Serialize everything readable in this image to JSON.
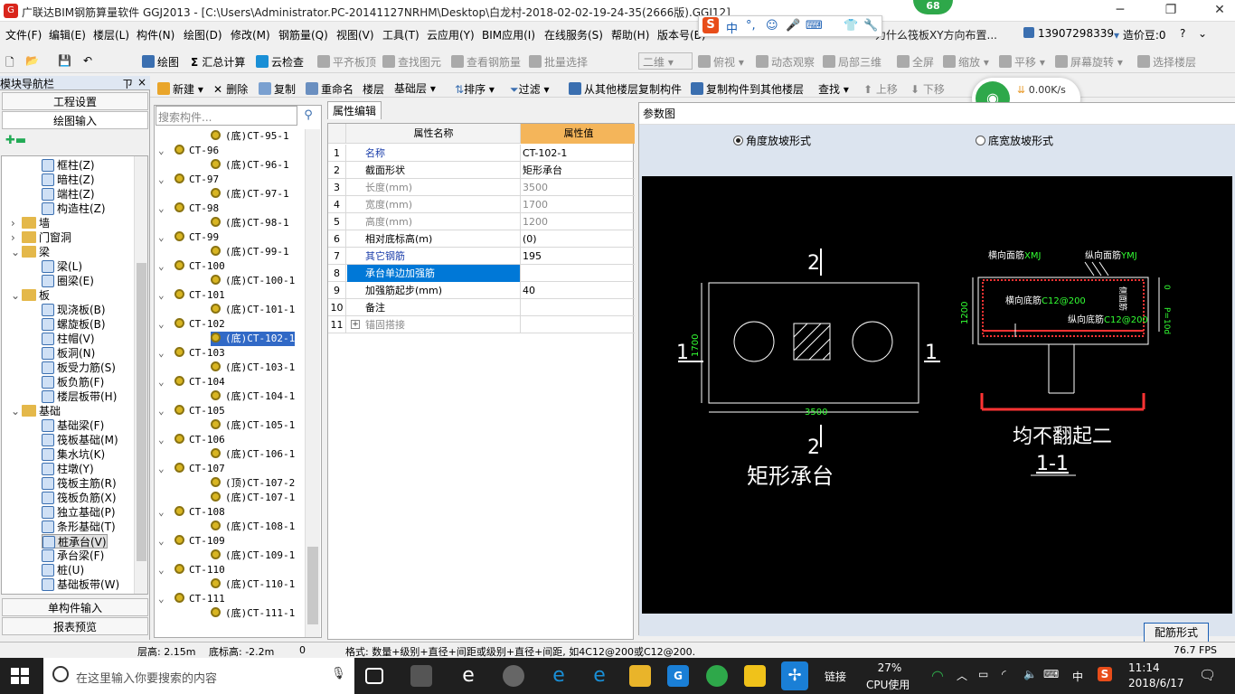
{
  "window": {
    "title": "广联达BIM钢筋算量软件 GGJ2013 - [C:\\Users\\Administrator.PC-20141127NRHM\\Desktop\\白龙村-2018-02-02-19-24-35(2666版).GGJ12]",
    "score_badge": "68"
  },
  "ime": {
    "items": [
      "中",
      "°,",
      "☺",
      "🎤",
      "⌨",
      "👕",
      "🔧"
    ]
  },
  "menu": {
    "items": [
      "文件(F)",
      "编辑(E)",
      "楼层(L)",
      "构件(N)",
      "绘图(D)",
      "修改(M)",
      "钢筋量(Q)",
      "视图(V)",
      "工具(T)",
      "云应用(Y)",
      "BIM应用(I)",
      "在线服务(S)",
      "帮助(H)",
      "版本号(B)"
    ],
    "news_text": "为什么筏板XY方向布置...",
    "phone": "13907298339",
    "price_beans": "造价豆:0"
  },
  "toolbar1": {
    "draw": "绘图",
    "sum": "汇总计算",
    "cloud_check": "云检查",
    "flat_top": "平齐板顶",
    "find_elem": "查找图元",
    "view_rebar": "查看钢筋量",
    "batch_select": "批量选择",
    "view_mode": "二维",
    "top_view": "俯视",
    "dynamic_view": "动态观察",
    "local_3d": "局部三维",
    "fullscreen": "全屏",
    "zoom": "缩放",
    "pan": "平移",
    "rotate_screen": "屏幕旋转",
    "select_floor": "选择楼层"
  },
  "toolbar2": {
    "new": "新建",
    "delete": "删除",
    "copy": "复制",
    "rename": "重命名",
    "floor_label": "楼层",
    "floor_value": "基础层",
    "sort": "排序",
    "filter": "过滤",
    "copy_from_other": "从其他楼层复制构件",
    "copy_to_other": "复制构件到其他楼层",
    "find": "查找",
    "move_up": "上移",
    "move_down": "下移"
  },
  "network": {
    "down": "0.00K/s",
    "up": "0"
  },
  "left_nav": {
    "title": "模块导航栏",
    "pin": "ㄗ",
    "close": "×",
    "btn_project": "工程设置",
    "btn_draw": "绘图输入",
    "btn_single": "单构件输入",
    "btn_report": "报表预览",
    "tree": [
      {
        "label": "框柱(Z)",
        "level": 2,
        "type": "comp"
      },
      {
        "label": "暗柱(Z)",
        "level": 2,
        "type": "comp"
      },
      {
        "label": "端柱(Z)",
        "level": 2,
        "type": "comp"
      },
      {
        "label": "构造柱(Z)",
        "level": 2,
        "type": "comp"
      },
      {
        "label": "墙",
        "level": 1,
        "type": "folder",
        "exp": ">"
      },
      {
        "label": "门窗洞",
        "level": 1,
        "type": "folder",
        "exp": ">"
      },
      {
        "label": "梁",
        "level": 1,
        "type": "folder",
        "exp": "v"
      },
      {
        "label": "梁(L)",
        "level": 2,
        "type": "comp"
      },
      {
        "label": "圈梁(E)",
        "level": 2,
        "type": "comp"
      },
      {
        "label": "板",
        "level": 1,
        "type": "folder",
        "exp": "v"
      },
      {
        "label": "现浇板(B)",
        "level": 2,
        "type": "comp"
      },
      {
        "label": "螺旋板(B)",
        "level": 2,
        "type": "comp"
      },
      {
        "label": "柱帽(V)",
        "level": 2,
        "type": "comp"
      },
      {
        "label": "板洞(N)",
        "level": 2,
        "type": "comp"
      },
      {
        "label": "板受力筋(S)",
        "level": 2,
        "type": "comp"
      },
      {
        "label": "板负筋(F)",
        "level": 2,
        "type": "comp"
      },
      {
        "label": "楼层板带(H)",
        "level": 2,
        "type": "comp"
      },
      {
        "label": "基础",
        "level": 1,
        "type": "folder",
        "exp": "v"
      },
      {
        "label": "基础梁(F)",
        "level": 2,
        "type": "comp"
      },
      {
        "label": "筏板基础(M)",
        "level": 2,
        "type": "comp"
      },
      {
        "label": "集水坑(K)",
        "level": 2,
        "type": "comp"
      },
      {
        "label": "柱墩(Y)",
        "level": 2,
        "type": "comp"
      },
      {
        "label": "筏板主筋(R)",
        "level": 2,
        "type": "comp"
      },
      {
        "label": "筏板负筋(X)",
        "level": 2,
        "type": "comp"
      },
      {
        "label": "独立基础(P)",
        "level": 2,
        "type": "comp"
      },
      {
        "label": "条形基础(T)",
        "level": 2,
        "type": "comp"
      },
      {
        "label": "桩承台(V)",
        "level": 2,
        "type": "comp",
        "selected": true
      },
      {
        "label": "承台梁(F)",
        "level": 2,
        "type": "comp"
      },
      {
        "label": "桩(U)",
        "level": 2,
        "type": "comp"
      },
      {
        "label": "基础板带(W)",
        "level": 2,
        "type": "comp"
      }
    ]
  },
  "components": {
    "search_placeholder": "搜索构件...",
    "items": [
      {
        "label": "(底)CT-95-1",
        "level": 2
      },
      {
        "label": "CT-96",
        "level": 1
      },
      {
        "label": "(底)CT-96-1",
        "level": 2
      },
      {
        "label": "CT-97",
        "level": 1
      },
      {
        "label": "(底)CT-97-1",
        "level": 2
      },
      {
        "label": "CT-98",
        "level": 1
      },
      {
        "label": "(底)CT-98-1",
        "level": 2
      },
      {
        "label": "CT-99",
        "level": 1
      },
      {
        "label": "(底)CT-99-1",
        "level": 2
      },
      {
        "label": "CT-100",
        "level": 1
      },
      {
        "label": "(底)CT-100-1",
        "level": 2
      },
      {
        "label": "CT-101",
        "level": 1
      },
      {
        "label": "(底)CT-101-1",
        "level": 2
      },
      {
        "label": "CT-102",
        "level": 1
      },
      {
        "label": "(底)CT-102-1",
        "level": 2,
        "selected": true
      },
      {
        "label": "CT-103",
        "level": 1
      },
      {
        "label": "(底)CT-103-1",
        "level": 2
      },
      {
        "label": "CT-104",
        "level": 1
      },
      {
        "label": "(底)CT-104-1",
        "level": 2
      },
      {
        "label": "CT-105",
        "level": 1
      },
      {
        "label": "(底)CT-105-1",
        "level": 2
      },
      {
        "label": "CT-106",
        "level": 1
      },
      {
        "label": "(底)CT-106-1",
        "level": 2
      },
      {
        "label": "CT-107",
        "level": 1
      },
      {
        "label": "(顶)CT-107-2",
        "level": 2
      },
      {
        "label": "(底)CT-107-1",
        "level": 2
      },
      {
        "label": "CT-108",
        "level": 1
      },
      {
        "label": "(底)CT-108-1",
        "level": 2
      },
      {
        "label": "CT-109",
        "level": 1
      },
      {
        "label": "(底)CT-109-1",
        "level": 2
      },
      {
        "label": "CT-110",
        "level": 1
      },
      {
        "label": "(底)CT-110-1",
        "level": 2
      },
      {
        "label": "CT-111",
        "level": 1
      },
      {
        "label": "(底)CT-111-1",
        "level": 2
      }
    ]
  },
  "properties": {
    "tab": "属性编辑",
    "col_name": "属性名称",
    "col_value": "属性值",
    "rows": [
      {
        "no": "1",
        "name": "名称",
        "value": "CT-102-1",
        "style": "blue"
      },
      {
        "no": "2",
        "name": "截面形状",
        "value": "矩形承台",
        "style": ""
      },
      {
        "no": "3",
        "name": "长度(mm)",
        "value": "3500",
        "style": "gray"
      },
      {
        "no": "4",
        "name": "宽度(mm)",
        "value": "1700",
        "style": "gray"
      },
      {
        "no": "5",
        "name": "高度(mm)",
        "value": "1200",
        "style": "gray"
      },
      {
        "no": "6",
        "name": "相对底标高(m)",
        "value": "(0)",
        "style": ""
      },
      {
        "no": "7",
        "name": "其它钢筋",
        "value": "195",
        "style": "blue"
      },
      {
        "no": "8",
        "name": "承台单边加强筋",
        "value": "",
        "style": "sel"
      },
      {
        "no": "9",
        "name": "加强筋起步(mm)",
        "value": "40",
        "style": ""
      },
      {
        "no": "10",
        "name": "备注",
        "value": "",
        "style": ""
      },
      {
        "no": "11",
        "name": "锚固搭接",
        "value": "",
        "style": "gray",
        "expand": "+"
      }
    ]
  },
  "param": {
    "title": "参数图",
    "radio1": "角度放坡形式",
    "radio2": "底宽放坡形式",
    "btn": "配筋形式",
    "drawing": {
      "plan_caption": "矩形承台",
      "sec_top": "2",
      "sec_bottom": "2",
      "sec_left": "1",
      "sec_right": "1",
      "dim_length": "3500",
      "dim_width": "1700",
      "section_caption": "均不翻起二",
      "section_name": "1-1",
      "lbl_top_h": "横向面筋",
      "lbl_top_h_code": "XMJ",
      "lbl_top_v": "纵向面筋",
      "lbl_top_v_code": "YMJ",
      "lbl_bot_h": "横向底筋",
      "lbl_bot_h_code": "C12@200",
      "lbl_bot_v": "纵向底筋",
      "lbl_bot_v_code": "C12@200",
      "lbl_side": "侧面筋",
      "dim_height": "1200",
      "dim_zero": "0",
      "dim_p": "P=10d"
    }
  },
  "status": {
    "floor_height": "层高: 2.15m",
    "bottom_elev": "底标高: -2.2m",
    "zero": "0",
    "format": "格式: 数量+级别+直径+间距或级别+直径+间距, 如4C12@200或C12@200.",
    "fps": "76.7 FPS"
  },
  "taskbar": {
    "search": "在这里输入你要搜索的内容",
    "link": "链接",
    "cpu_pct": "27%",
    "cpu_label": "CPU使用",
    "lang": "中",
    "time": "11:14",
    "date": "2018/6/17"
  }
}
